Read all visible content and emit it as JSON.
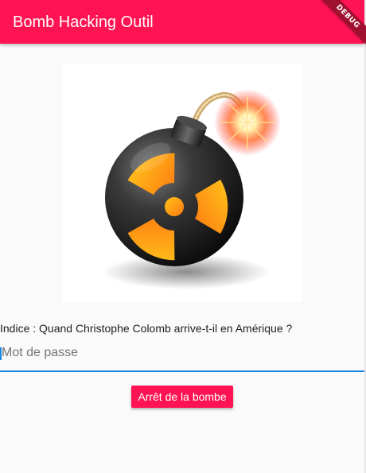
{
  "appbar": {
    "title": "Bomb Hacking Outil",
    "color": "#ff1352"
  },
  "debug_banner": {
    "label": "DEBUG"
  },
  "main": {
    "image_icon": "bomb-radioactive-icon",
    "hint": "Indice : Quand Christophe Colomb arrive-t-il en Amérique ?",
    "password": {
      "placeholder": "Mot de passe",
      "value": ""
    },
    "button_label": "Arrêt de la bombe",
    "focus_color": "#1e88e5"
  }
}
